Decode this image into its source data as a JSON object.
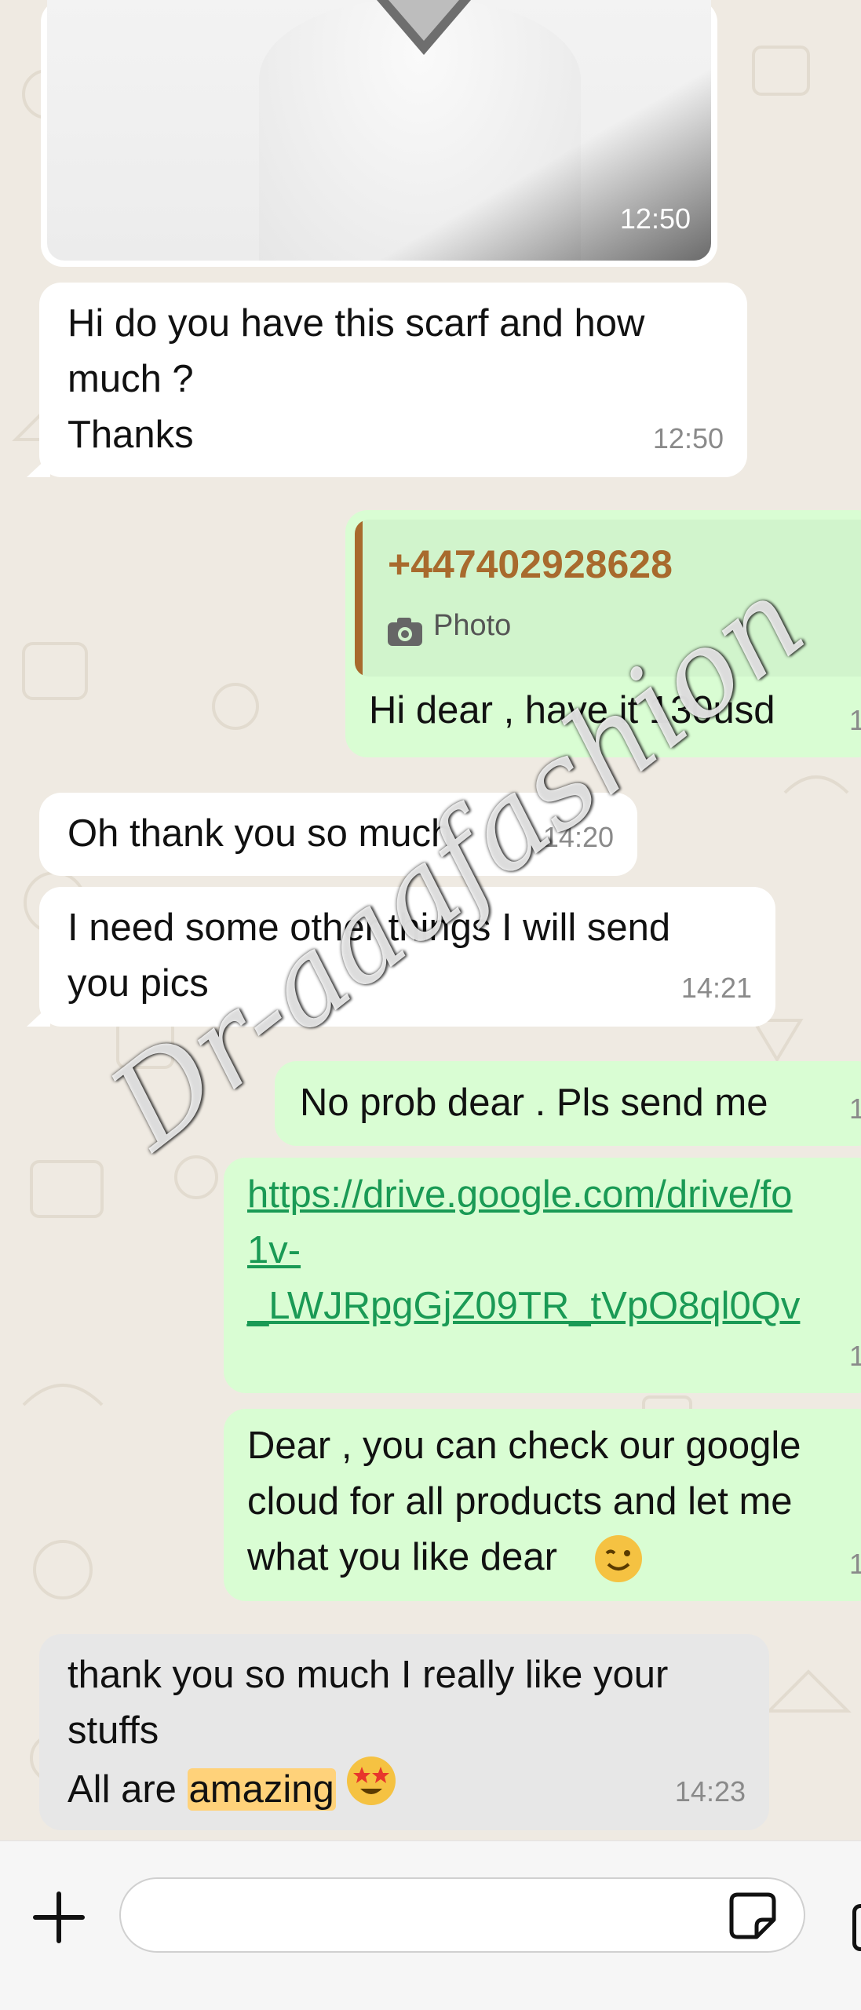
{
  "chat": {
    "image_message": {
      "time": "12:50"
    },
    "messages": [
      {
        "lines": [
          "Hi do you have this scarf and how",
          "much ?",
          "Thanks"
        ],
        "time": "12:50"
      },
      {
        "quote_number": "+447402928628",
        "quote_caption": "Photo",
        "text": "Hi dear , have it 130usd",
        "time": "1"
      },
      {
        "text": "Oh thank you so much",
        "time": "14:20"
      },
      {
        "lines": [
          "I need some other things I will send",
          "you pics"
        ],
        "time": "14:21"
      },
      {
        "text": "No prob dear . Pls send me",
        "time": "1"
      },
      {
        "lines": [
          "https://drive.google.com/drive/fo",
          "1v-",
          "_LWJRpgGjZ09TR_tVpO8ql0Qv"
        ],
        "time": "1"
      },
      {
        "lines": [
          "Dear , you can check our google",
          "cloud for all products and let me",
          "what you like dear"
        ],
        "time": "1"
      },
      {
        "line1": "thank you so much I really like your",
        "line2": "stuffs",
        "line3_prefix": "All are ",
        "line3_highlight": "amazing",
        "time": "14:23"
      }
    ],
    "watermark": "Dr-aaafashion"
  },
  "colors": {
    "incoming": "#ffffff",
    "outgoing": "#d9fdd3",
    "selected": "#e7e7e7",
    "link": "#1a9a55",
    "highlight": "#ffd27a",
    "quote_accent": "#a86a2d",
    "wallpaper": "#efeae2"
  },
  "icons": {
    "add": "plus-icon",
    "sticker": "sticker-icon",
    "camera": "camera-icon",
    "wink": "winking-face-emoji",
    "star": "star-struck-emoji"
  },
  "composer": {
    "value": ""
  }
}
